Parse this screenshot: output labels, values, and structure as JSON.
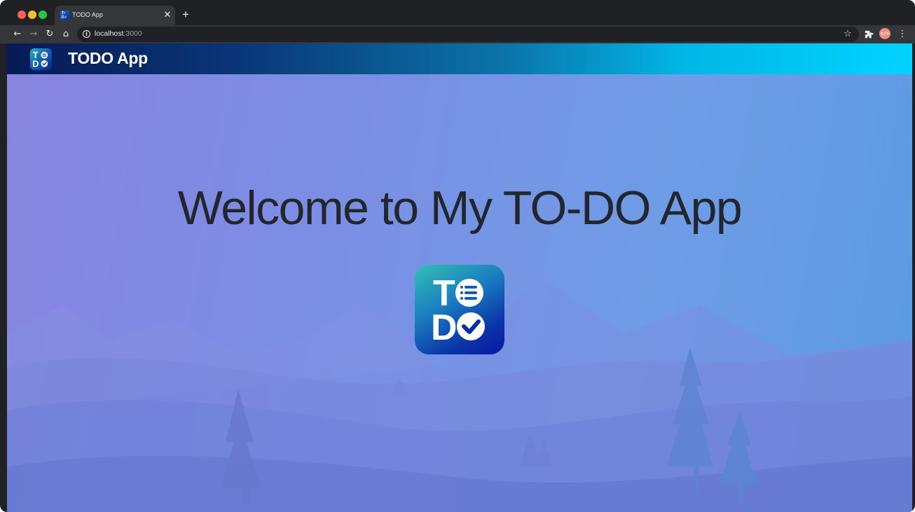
{
  "browser": {
    "tab_title": "TODO App",
    "tab_favicon_text": "T\nD",
    "url_host": "localhost",
    "url_port": ":3000"
  },
  "app": {
    "header_title": "TODO App",
    "welcome_heading": "Welcome to My TO-DO App",
    "logo_letters": {
      "top": "T",
      "bottom": "D"
    }
  },
  "colors": {
    "header_gradient_start": "#061a55",
    "header_gradient_end": "#00d3ff",
    "background_start": "#8884e0",
    "background_end": "#5a9be0",
    "heading_text": "#24262e"
  },
  "icons": {
    "back": "arrow-left",
    "forward": "arrow-right",
    "reload": "reload",
    "home": "home",
    "site_info": "info",
    "bookmark": "star",
    "extensions": "puzzle",
    "devtools_ext": "code",
    "menu": "kebab"
  }
}
